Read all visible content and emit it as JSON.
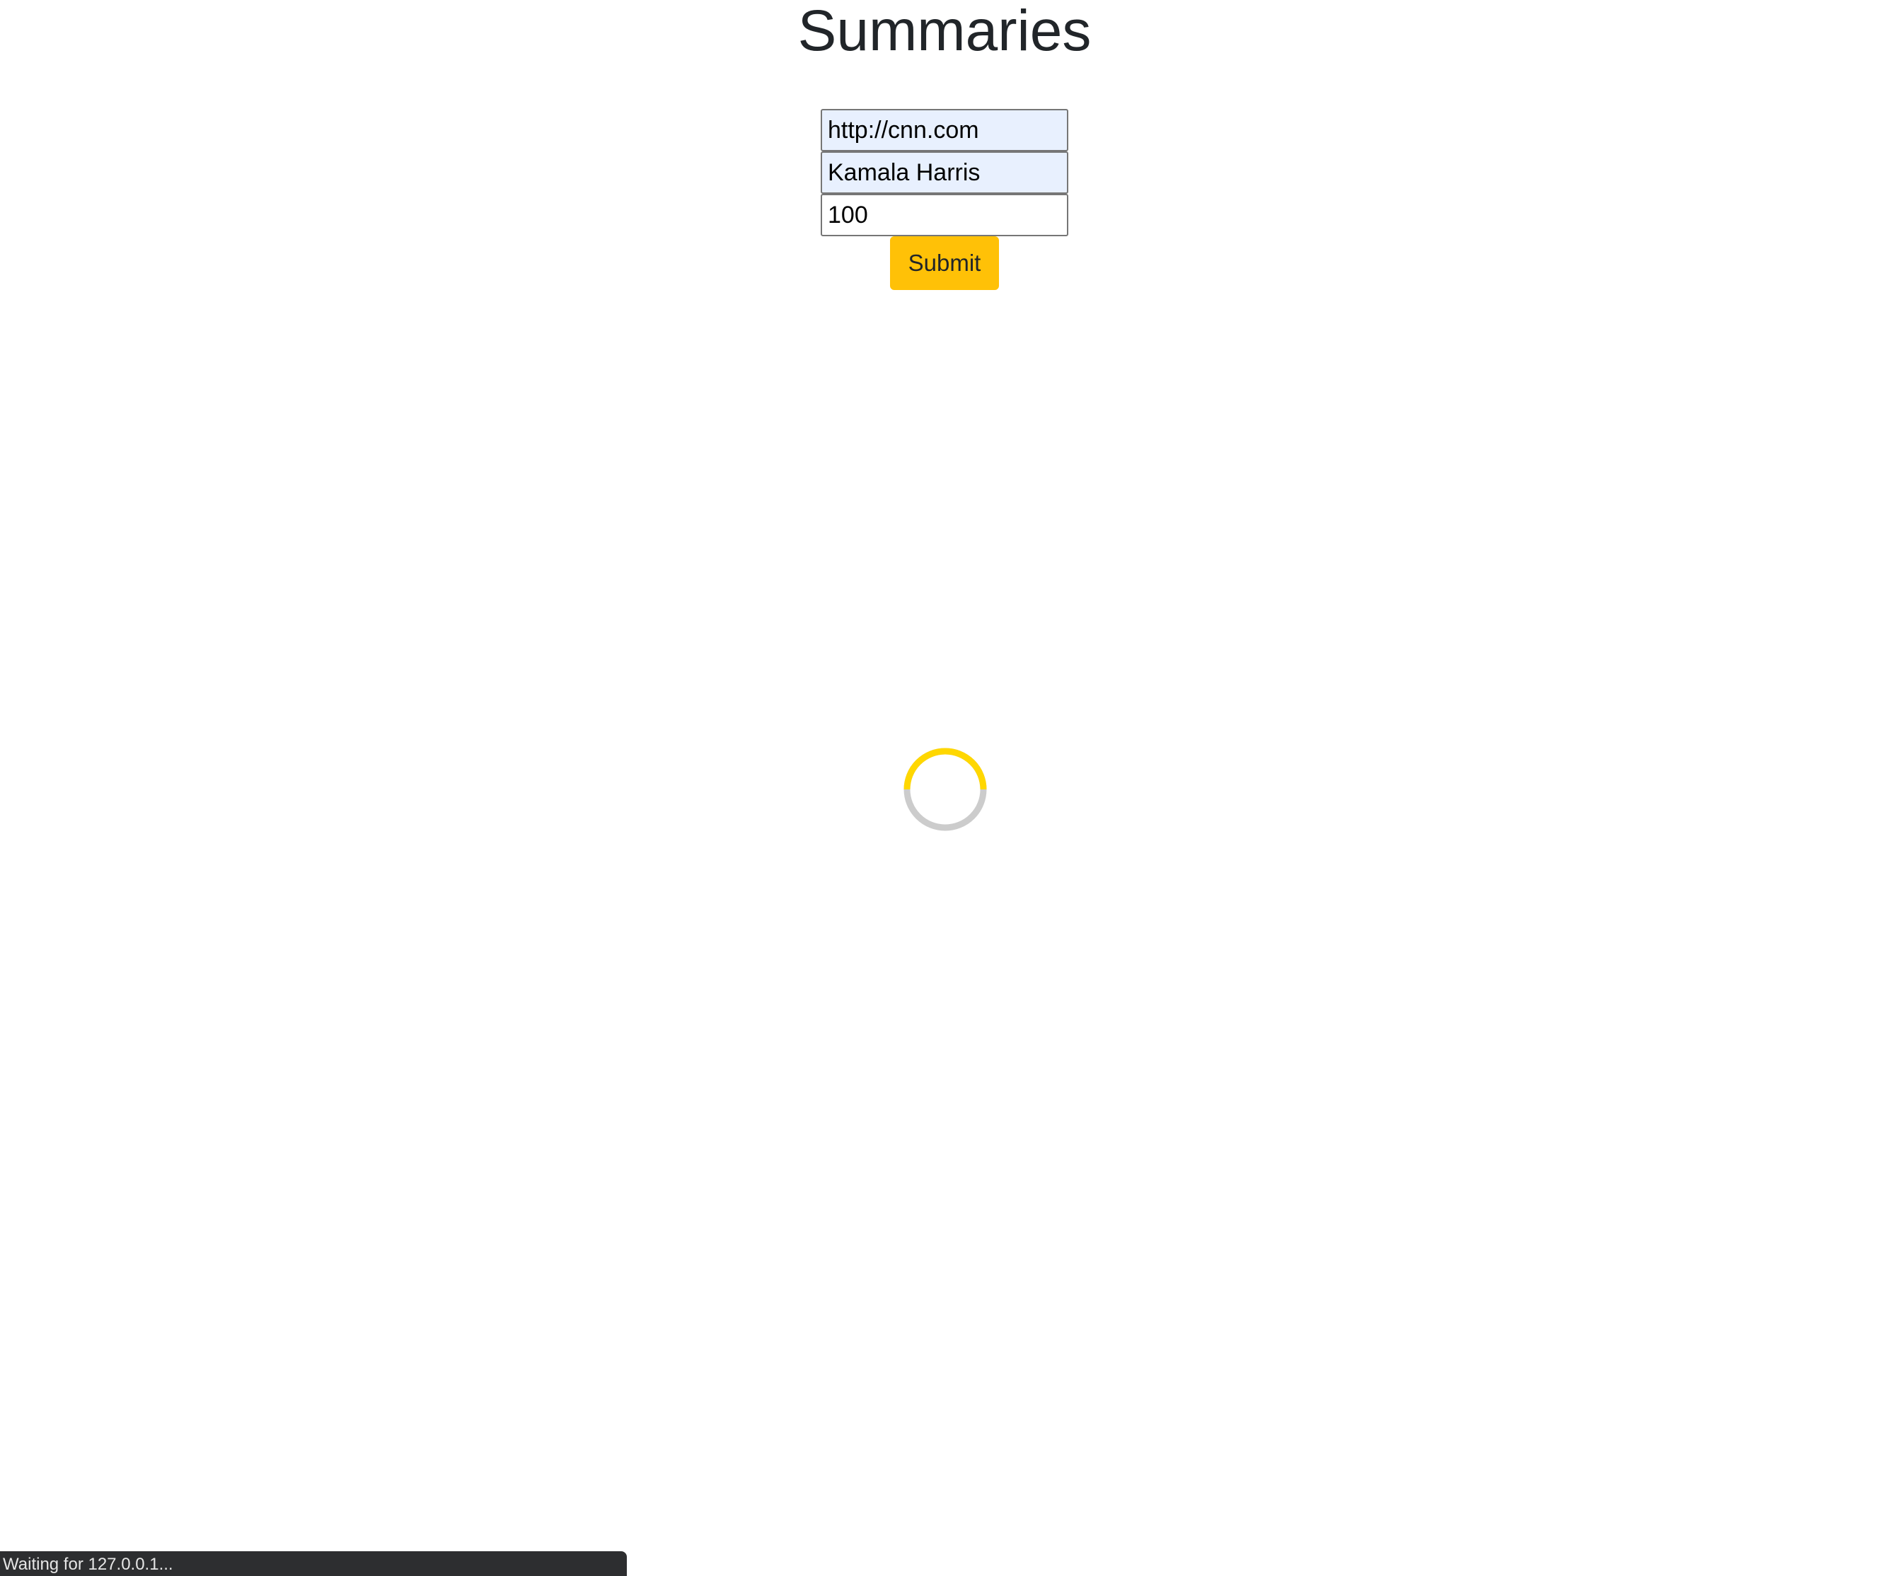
{
  "page": {
    "title": "Summaries"
  },
  "form": {
    "url_value": "http://cnn.com",
    "query_value": "Kamala Harris",
    "count_value": "100",
    "submit_label": "Submit"
  },
  "loading": {
    "icon": "loading-spinner-icon",
    "accent_color": "#ffd700",
    "track_color": "#cccccc"
  },
  "status_bar": {
    "text": "Waiting for 127.0.0.1..."
  },
  "colors": {
    "submit_bg": "#ffc107",
    "autofill_bg": "#e8f0fe"
  }
}
